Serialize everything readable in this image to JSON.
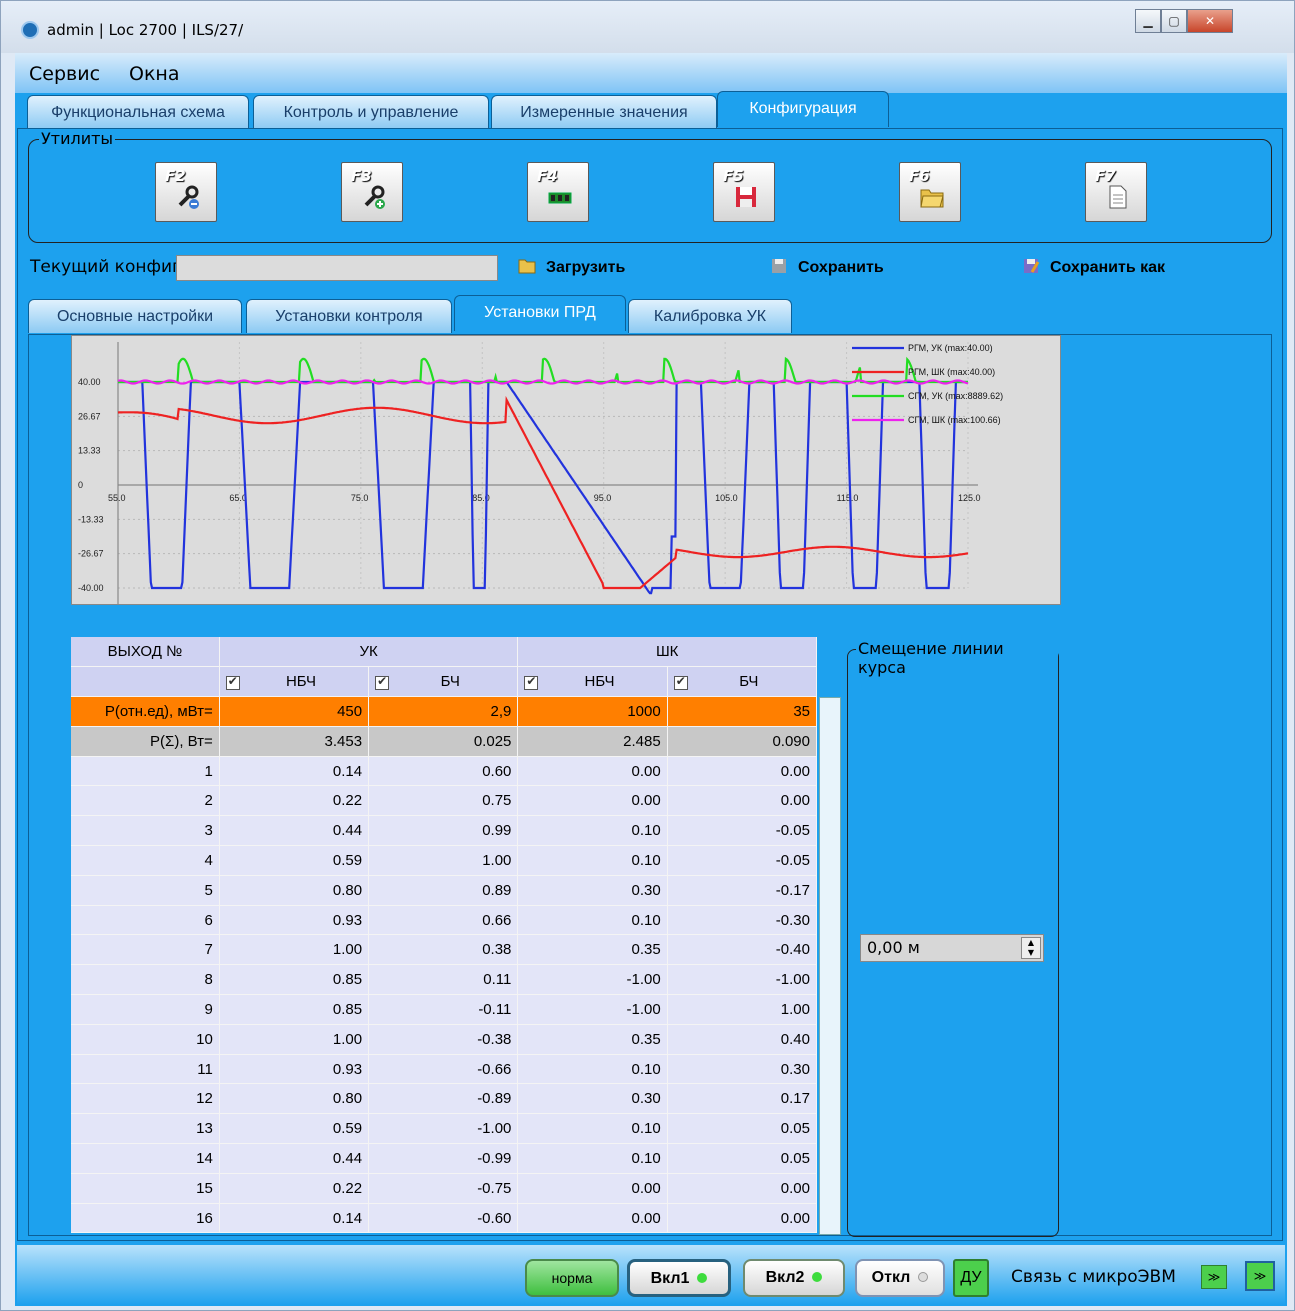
{
  "window": {
    "title": "admin | Loc 2700 | ILS/27/"
  },
  "menu": [
    "Сервис",
    "Окна"
  ],
  "main_tabs": [
    "Функциональная схема",
    "Контроль и управление",
    "Измеренные значения",
    "Конфигурация"
  ],
  "utilities": {
    "label": "Утилиты",
    "buttons": [
      {
        "key": "F2",
        "icon": "wrench-arrow-icon"
      },
      {
        "key": "F3",
        "icon": "wrench-plus-icon"
      },
      {
        "key": "F4",
        "icon": "memory-chip-icon"
      },
      {
        "key": "F5",
        "icon": "save-disk-icon"
      },
      {
        "key": "F6",
        "icon": "open-folder-icon"
      },
      {
        "key": "F7",
        "icon": "document-icon"
      }
    ]
  },
  "config": {
    "label": "Текущий конфиг",
    "value": "",
    "load": "Загрузить",
    "save": "Сохранить",
    "save_as": "Сохранить как"
  },
  "sub_tabs": [
    "Основные настройки",
    "Установки контроля",
    "Установки ПРД",
    "Калибровка УК"
  ],
  "chart_data": {
    "type": "line",
    "x_ticks": [
      "55.0",
      "65.0",
      "75.0",
      "85.0",
      "95.0",
      "105.0",
      "115.0",
      "125.0"
    ],
    "y_ticks": [
      "40.00",
      "26.67",
      "13.33",
      "0",
      "-13.33",
      "-26.67",
      "-40.00"
    ],
    "xlim": [
      55,
      125
    ],
    "ylim": [
      -40,
      40
    ],
    "legend_position": "top-right",
    "series": [
      {
        "name": "РГМ, УК (max:40.00)",
        "color": "#2233dd"
      },
      {
        "name": "РГМ, ШК (max:40.00)",
        "color": "#ee2222"
      },
      {
        "name": "СГМ, УК (max:8889.62)",
        "color": "#22dd22"
      },
      {
        "name": "СГМ, ШК (max:100.66)",
        "color": "#ee22ee"
      }
    ]
  },
  "table": {
    "header1": [
      "ВЫХОД №",
      "УК",
      "ШК"
    ],
    "header2": [
      "НБЧ",
      "БЧ",
      "НБЧ",
      "БЧ"
    ],
    "power_row": [
      "P(отн.ед), мВт=",
      "450",
      "2,9",
      "1000",
      "35"
    ],
    "sum_row": [
      "P(Σ), Вт=",
      "3.453",
      "0.025",
      "2.485",
      "0.090"
    ],
    "rows": [
      [
        "1",
        "0.14",
        "0.60",
        "0.00",
        "0.00"
      ],
      [
        "2",
        "0.22",
        "0.75",
        "0.00",
        "0.00"
      ],
      [
        "3",
        "0.44",
        "0.99",
        "0.10",
        "-0.05"
      ],
      [
        "4",
        "0.59",
        "1.00",
        "0.10",
        "-0.05"
      ],
      [
        "5",
        "0.80",
        "0.89",
        "0.30",
        "-0.17"
      ],
      [
        "6",
        "0.93",
        "0.66",
        "0.10",
        "-0.30"
      ],
      [
        "7",
        "1.00",
        "0.38",
        "0.35",
        "-0.40"
      ],
      [
        "8",
        "0.85",
        "0.11",
        "-1.00",
        "-1.00"
      ],
      [
        "9",
        "0.85",
        "-0.11",
        "-1.00",
        "1.00"
      ],
      [
        "10",
        "1.00",
        "-0.38",
        "0.35",
        "0.40"
      ],
      [
        "11",
        "0.93",
        "-0.66",
        "0.10",
        "0.30"
      ],
      [
        "12",
        "0.80",
        "-0.89",
        "0.30",
        "0.17"
      ],
      [
        "13",
        "0.59",
        "-1.00",
        "0.10",
        "0.05"
      ],
      [
        "14",
        "0.44",
        "-0.99",
        "0.10",
        "0.05"
      ],
      [
        "15",
        "0.22",
        "-0.75",
        "0.00",
        "0.00"
      ],
      [
        "16",
        "0.14",
        "-0.60",
        "0.00",
        "0.00"
      ]
    ]
  },
  "offset": {
    "label": "Смещение линии курса",
    "value": "0,00 м"
  },
  "status": {
    "norm": "норма",
    "on1": "Вкл1",
    "on2": "Вкл2",
    "off": "Откл",
    "du": "ДУ",
    "link": "Связь с микроЭВМ"
  }
}
